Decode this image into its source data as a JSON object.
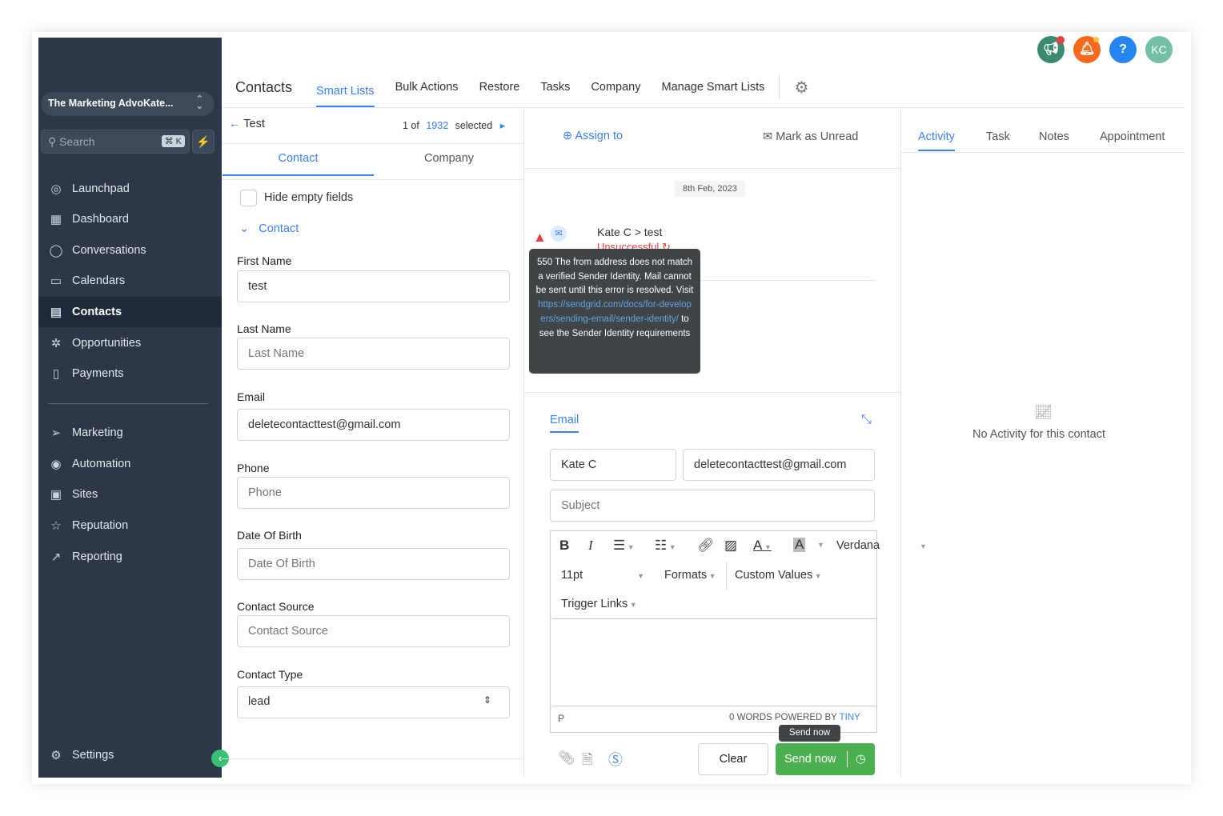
{
  "sidebar": {
    "account": "The Marketing AdvoKate...",
    "search_placeholder": "Search",
    "search_shortcut": "⌘ K",
    "items": [
      {
        "label": "Launchpad"
      },
      {
        "label": "Dashboard"
      },
      {
        "label": "Conversations"
      },
      {
        "label": "Calendars"
      },
      {
        "label": "Contacts"
      },
      {
        "label": "Opportunities"
      },
      {
        "label": "Payments"
      },
      {
        "label": "Marketing"
      },
      {
        "label": "Automation"
      },
      {
        "label": "Sites"
      },
      {
        "label": "Reputation"
      },
      {
        "label": "Reporting"
      }
    ],
    "settings": "Settings"
  },
  "header": {
    "title": "Contacts",
    "tabs": [
      "Smart Lists",
      "Bulk Actions",
      "Restore",
      "Tasks",
      "Company",
      "Manage Smart Lists"
    ],
    "avatar": "KC",
    "help": "?"
  },
  "contact_panel": {
    "back_label": "Test",
    "pager_prefix": "1 of",
    "pager_count": "1932",
    "pager_suffix": "selected",
    "tabs": [
      "Contact",
      "Company"
    ],
    "hide_empty": "Hide empty fields",
    "section": "Contact",
    "fields": [
      {
        "label": "First Name",
        "value": "test",
        "placeholder": ""
      },
      {
        "label": "Last Name",
        "value": "",
        "placeholder": "Last Name"
      },
      {
        "label": "Email",
        "value": "deletecontacttest@gmail.com",
        "placeholder": ""
      },
      {
        "label": "Phone",
        "value": "",
        "placeholder": "Phone"
      },
      {
        "label": "Date Of Birth",
        "value": "",
        "placeholder": "Date Of Birth"
      },
      {
        "label": "Contact Source",
        "value": "",
        "placeholder": "Contact Source"
      }
    ],
    "contact_type_label": "Contact Type",
    "contact_type_value": "lead"
  },
  "conversation": {
    "assign": "Assign to",
    "mark_unread": "Mark as Unread",
    "date": "8th Feb, 2023",
    "from": "Kate C",
    "to": "test",
    "status": "Unsuccessful",
    "tooltip": {
      "text1": "550 The from address does not match a verified Sender Identity. Mail cannot be sent until this error is resolved. Visit",
      "link": "https://sendgrid.com/docs/for-developers/sending-email/sender-identity/",
      "text2": "to see the Sender Identity requirements"
    }
  },
  "composer": {
    "tab": "Email",
    "from_name": "Kate C",
    "from_email": "deletecontacttest@gmail.com",
    "subject_placeholder": "Subject",
    "font": "Verdana",
    "size": "11pt",
    "formats": "Formats",
    "custom_values": "Custom Values",
    "trigger_links": "Trigger Links",
    "path": "P",
    "words": "0 WORDS",
    "powered": "POWERED BY",
    "tiny": "TINY",
    "clear": "Clear",
    "send": "Send now",
    "send_tooltip": "Send now"
  },
  "activity": {
    "tabs": [
      "Activity",
      "Task",
      "Notes",
      "Appointment"
    ],
    "empty": "No Activity for this contact"
  }
}
